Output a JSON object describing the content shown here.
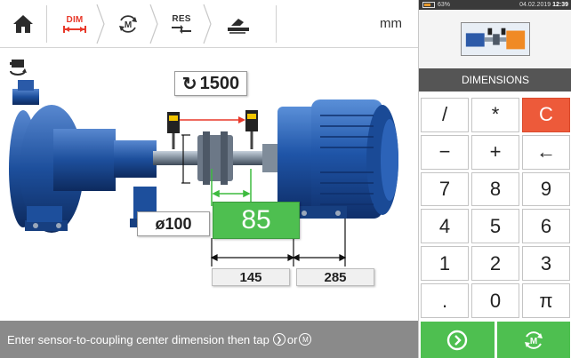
{
  "toolbar": {
    "steps": [
      {
        "label": "DIM",
        "icon": "dimensions-icon",
        "active": true
      },
      {
        "label": "",
        "icon": "measure-icon",
        "active": false
      },
      {
        "label": "RES",
        "icon": "results-icon",
        "active": false
      },
      {
        "label": "",
        "icon": "correction-icon",
        "active": false
      }
    ],
    "units": "mm"
  },
  "rail": {
    "icon": "machine-rotate-icon"
  },
  "measurements": {
    "rpm": "1500",
    "rpm_icon": "↻",
    "coupling_diameter": "ø100",
    "sensor_to_coupling": "85",
    "dist_coupling_to_front_feet": "145",
    "dist_front_to_back_feet": "285"
  },
  "status": {
    "message": "Enter sensor-to-coupling center dimension then tap",
    "or_text": "or"
  },
  "panel": {
    "battery": "63%",
    "date": "04.02.2019",
    "time": "12:39",
    "title": "DIMENSIONS",
    "keys": [
      "/",
      "*",
      "C",
      "−",
      "+",
      "←",
      "7",
      "8",
      "9",
      "4",
      "5",
      "6",
      "1",
      "2",
      "3",
      ".",
      "0",
      "π"
    ],
    "actions": [
      {
        "icon": "next-arrow-icon"
      },
      {
        "icon": "measure-mode-icon"
      }
    ]
  },
  "colors": {
    "accent_red": "#e8392a",
    "green": "#4ebf50",
    "motor_blue": "#1d4f9c",
    "status_gray": "#8a8a8a"
  }
}
